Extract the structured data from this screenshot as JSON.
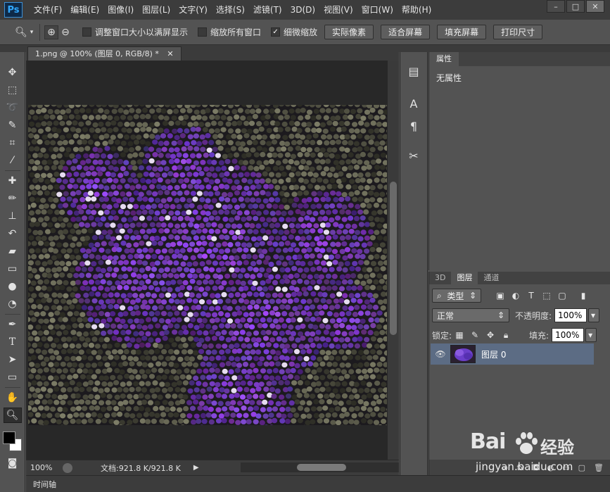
{
  "app": {
    "logo": "Ps"
  },
  "menu": [
    "文件(F)",
    "编辑(E)",
    "图像(I)",
    "图层(L)",
    "文字(Y)",
    "选择(S)",
    "滤镜(T)",
    "3D(D)",
    "视图(V)",
    "窗口(W)",
    "帮助(H)"
  ],
  "options": {
    "resize_windows": "调整窗口大小以满屏显示",
    "zoom_all": "缩放所有窗口",
    "scrubby_zoom": "细微缩放",
    "btn_actual": "实际像素",
    "btn_fit": "适合屏幕",
    "btn_fill": "填充屏幕",
    "btn_print": "打印尺寸"
  },
  "document": {
    "tab_title": "1.png @ 100% (图层 0, RGB/8) *",
    "zoom": "100%",
    "doc_info": "文档:921.8 K/921.8 K"
  },
  "properties": {
    "tab": "属性",
    "empty": "无属性"
  },
  "layers": {
    "tabs": [
      "3D",
      "图层",
      "通道"
    ],
    "kind": "类型",
    "blend_mode": "正常",
    "opacity_label": "不透明度:",
    "opacity": "100%",
    "lock_label": "锁定:",
    "fill_label": "填充:",
    "fill": "100%",
    "layer_name": "图层 0"
  },
  "timeline": {
    "label": "时间轴"
  },
  "watermark": {
    "brand": "Bai",
    "brand2": "经验",
    "url": "jingyan.baidu.com"
  }
}
